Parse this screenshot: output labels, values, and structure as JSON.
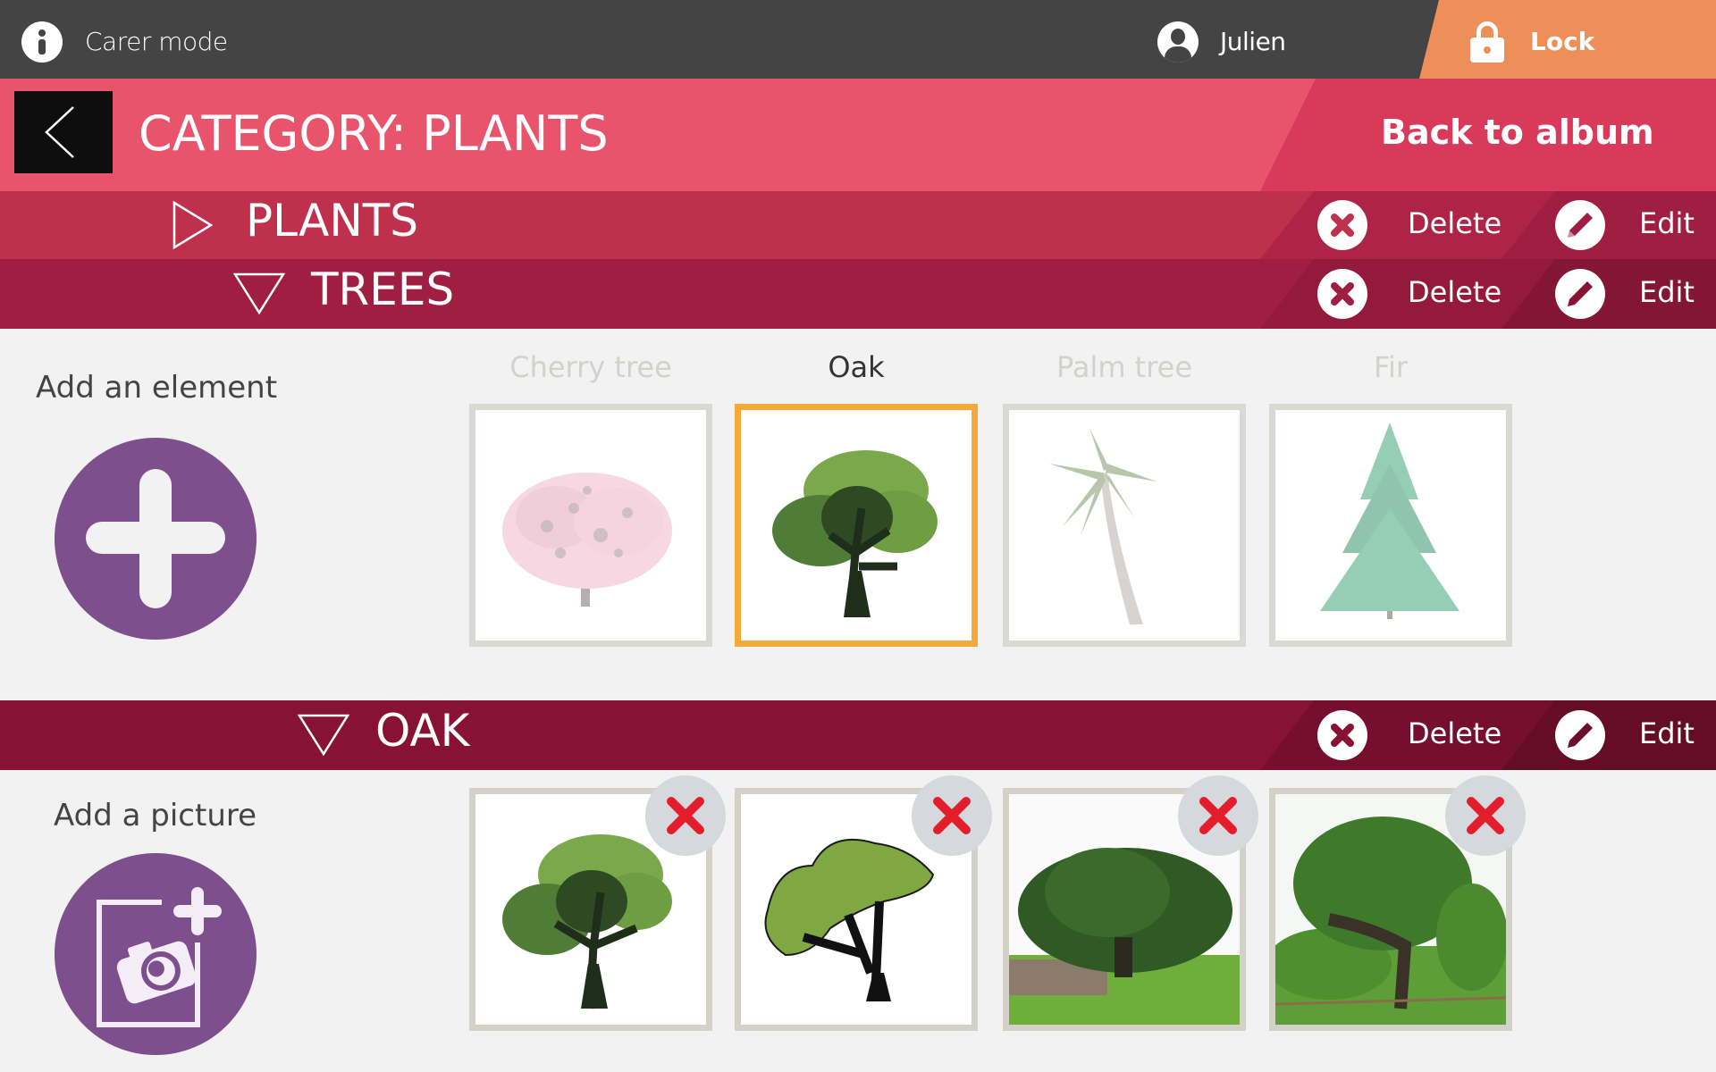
{
  "topbar": {
    "mode_label": "Carer mode",
    "user_name": "Julien",
    "lock_label": "Lock"
  },
  "header": {
    "title": "CATEGORY:  PLANTS",
    "back_to_album": "Back to album"
  },
  "rows": {
    "plants": {
      "title": "PLANTS",
      "expanded": false,
      "delete_label": "Delete",
      "edit_label": "Edit"
    },
    "trees": {
      "title": "TREES",
      "expanded": true,
      "delete_label": "Delete",
      "edit_label": "Edit"
    },
    "oak": {
      "title": "OAK",
      "expanded": true,
      "delete_label": "Delete",
      "edit_label": "Edit"
    }
  },
  "elements": {
    "add_label": "Add an element",
    "items": [
      {
        "label": "Cherry tree",
        "selected": false,
        "image": "cherry-tree"
      },
      {
        "label": "Oak",
        "selected": true,
        "image": "oak-tree"
      },
      {
        "label": "Palm tree",
        "selected": false,
        "image": "palm-tree"
      },
      {
        "label": "Fir",
        "selected": false,
        "image": "fir-tree"
      }
    ]
  },
  "pictures": {
    "add_label": "Add a picture",
    "items": [
      {
        "image": "oak-illustration-leafy"
      },
      {
        "image": "oak-illustration-simple"
      },
      {
        "image": "oak-photo-field"
      },
      {
        "image": "oak-photo-park"
      }
    ]
  },
  "colors": {
    "topbar": "#444444",
    "lock": "#EE8F5A",
    "header": "#E8546B",
    "plants_row": "#BF304D",
    "trees_row": "#A01E41",
    "oak_row": "#881236",
    "accent_purple": "#7E4F8D",
    "selected_border": "#F6A93B",
    "delete_red": "#E31E2A"
  }
}
